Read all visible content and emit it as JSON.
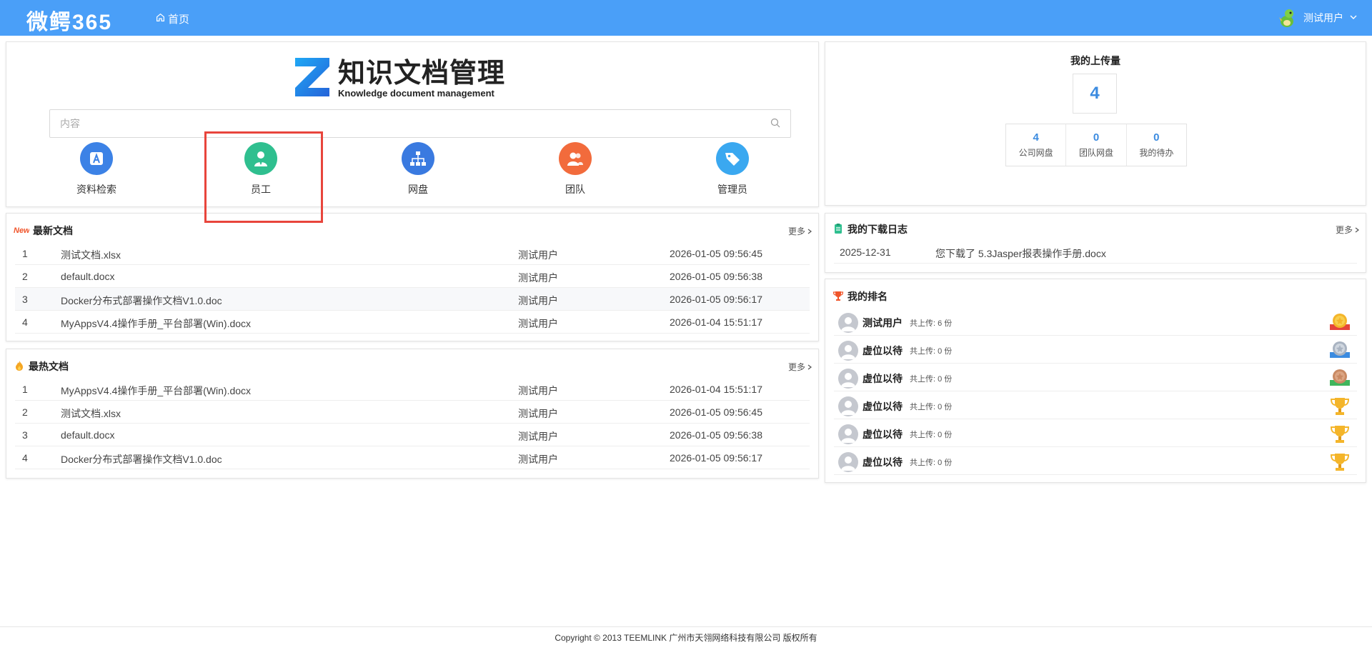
{
  "header": {
    "brand": "微鳄365",
    "home_label": "首页",
    "user_name": "测试用户"
  },
  "logo": {
    "title": "知识文档管理",
    "subtitle": "Knowledge document management"
  },
  "search": {
    "placeholder": "内容"
  },
  "quick_links": [
    {
      "label": "资料检索",
      "icon": "app-store-icon"
    },
    {
      "label": "员工",
      "icon": "person-icon"
    },
    {
      "label": "网盘",
      "icon": "org-tree-icon"
    },
    {
      "label": "团队",
      "icon": "team-icon"
    },
    {
      "label": "管理员",
      "icon": "tag-icon"
    }
  ],
  "upload": {
    "title": "我的上传量",
    "count": "4",
    "stats": [
      {
        "value": "4",
        "label": "公司网盘"
      },
      {
        "value": "0",
        "label": "团队网盘"
      },
      {
        "value": "0",
        "label": "我的待办"
      }
    ]
  },
  "latest": {
    "badge": "New",
    "title": "最新文档",
    "more": "更多",
    "rows": [
      {
        "idx": "1",
        "name": "测试文档.xlsx",
        "user": "测试用户",
        "time": "2026-01-05 09:56:45"
      },
      {
        "idx": "2",
        "name": "default.docx",
        "user": "测试用户",
        "time": "2026-01-05 09:56:38"
      },
      {
        "idx": "3",
        "name": "Docker分布式部署操作文档V1.0.doc",
        "user": "测试用户",
        "time": "2026-01-05 09:56:17"
      },
      {
        "idx": "4",
        "name": "MyAppsV4.4操作手册_平台部署(Win).docx",
        "user": "测试用户",
        "time": "2026-01-04 15:51:17"
      }
    ]
  },
  "hot": {
    "title": "最热文档",
    "more": "更多",
    "rows": [
      {
        "idx": "1",
        "name": "MyAppsV4.4操作手册_平台部署(Win).docx",
        "user": "测试用户",
        "time": "2026-01-04 15:51:17"
      },
      {
        "idx": "2",
        "name": "测试文档.xlsx",
        "user": "测试用户",
        "time": "2026-01-05 09:56:45"
      },
      {
        "idx": "3",
        "name": "default.docx",
        "user": "测试用户",
        "time": "2026-01-05 09:56:38"
      },
      {
        "idx": "4",
        "name": "Docker分布式部署操作文档V1.0.doc",
        "user": "测试用户",
        "time": "2026-01-05 09:56:17"
      }
    ]
  },
  "download_log": {
    "title": "我的下载日志",
    "more": "更多",
    "entry": {
      "date": "2025-12-31",
      "text": "您下载了 5.3Jasper报表操作手册.docx"
    }
  },
  "ranking": {
    "title": "我的排名",
    "rows": [
      {
        "name": "测试用户",
        "uploads": "共上传: 6 份",
        "medal": "gold-medal-icon"
      },
      {
        "name": "虚位以待",
        "uploads": "共上传: 0 份",
        "medal": "silver-medal-icon"
      },
      {
        "name": "虚位以待",
        "uploads": "共上传: 0 份",
        "medal": "bronze-medal-icon"
      },
      {
        "name": "虚位以待",
        "uploads": "共上传: 0 份",
        "medal": "trophy-icon"
      },
      {
        "name": "虚位以待",
        "uploads": "共上传: 0 份",
        "medal": "trophy-icon"
      },
      {
        "name": "虚位以待",
        "uploads": "共上传: 0 份",
        "medal": "trophy-icon"
      }
    ]
  },
  "footer": {
    "text": "Copyright © 2013 TEEMLINK 广州市天翎网络科技有限公司 版权所有"
  },
  "colors": {
    "header_bg": "#4a9ff8",
    "accent": "#3b8be0",
    "highlight": "#e8453c"
  }
}
